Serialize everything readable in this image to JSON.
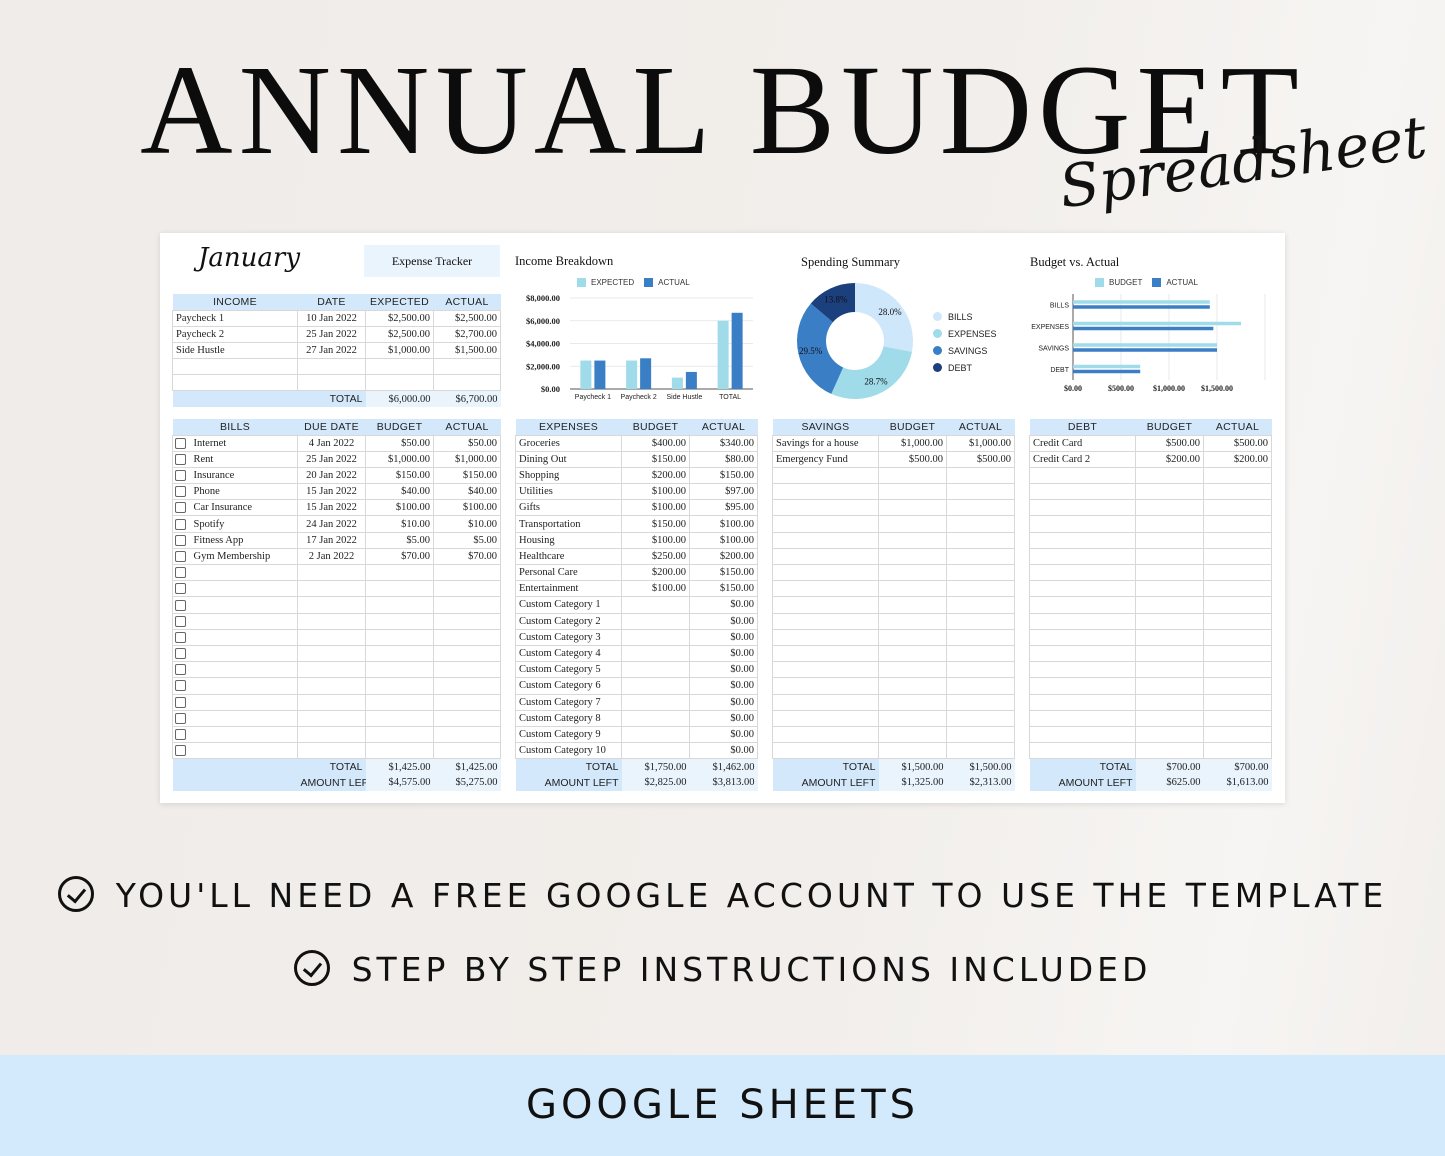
{
  "hero": {
    "title": "ANNUAL BUDGET",
    "script": "Spreadsheet"
  },
  "sheet": {
    "month": "January",
    "tracker_label": "Expense Tracker",
    "income": {
      "headers": [
        "INCOME",
        "DATE",
        "EXPECTED",
        "ACTUAL"
      ],
      "rows": [
        [
          "Paycheck 1",
          "10 Jan 2022",
          "$2,500.00",
          "$2,500.00"
        ],
        [
          "Paycheck 2",
          "25 Jan 2022",
          "$2,500.00",
          "$2,700.00"
        ],
        [
          "Side Hustle",
          "27 Jan 2022",
          "$1,000.00",
          "$1,500.00"
        ],
        [
          "",
          "",
          "",
          ""
        ],
        [
          "",
          "",
          "",
          ""
        ]
      ],
      "total_label": "TOTAL",
      "total_expected": "$6,000.00",
      "total_actual": "$6,700.00"
    },
    "bills": {
      "headers": [
        "BILLS",
        "DUE DATE",
        "BUDGET",
        "ACTUAL"
      ],
      "rows": [
        [
          "Internet",
          "4 Jan 2022",
          "$50.00",
          "$50.00"
        ],
        [
          "Rent",
          "25 Jan 2022",
          "$1,000.00",
          "$1,000.00"
        ],
        [
          "Insurance",
          "20 Jan 2022",
          "$150.00",
          "$150.00"
        ],
        [
          "Phone",
          "15 Jan 2022",
          "$40.00",
          "$40.00"
        ],
        [
          "Car Insurance",
          "15 Jan 2022",
          "$100.00",
          "$100.00"
        ],
        [
          "Spotify",
          "24 Jan 2022",
          "$10.00",
          "$10.00"
        ],
        [
          "Fitness App",
          "17 Jan 2022",
          "$5.00",
          "$5.00"
        ],
        [
          "Gym Membership",
          "2 Jan 2022",
          "$70.00",
          "$70.00"
        ],
        [
          "",
          "",
          "",
          ""
        ],
        [
          "",
          "",
          "",
          ""
        ],
        [
          "",
          "",
          "",
          ""
        ],
        [
          "",
          "",
          "",
          ""
        ],
        [
          "",
          "",
          "",
          ""
        ],
        [
          "",
          "",
          "",
          ""
        ],
        [
          "",
          "",
          "",
          ""
        ],
        [
          "",
          "",
          "",
          ""
        ],
        [
          "",
          "",
          "",
          ""
        ],
        [
          "",
          "",
          "",
          ""
        ],
        [
          "",
          "",
          "",
          ""
        ],
        [
          "",
          "",
          "",
          ""
        ]
      ],
      "total_label": "TOTAL",
      "total_budget": "$1,425.00",
      "total_actual": "$1,425.00",
      "left_label": "AMOUNT LEFT",
      "left_budget": "$4,575.00",
      "left_actual": "$5,275.00"
    },
    "expenses": {
      "headers": [
        "EXPENSES",
        "BUDGET",
        "ACTUAL"
      ],
      "rows": [
        [
          "Groceries",
          "$400.00",
          "$340.00"
        ],
        [
          "Dining Out",
          "$150.00",
          "$80.00"
        ],
        [
          "Shopping",
          "$200.00",
          "$150.00"
        ],
        [
          "Utilities",
          "$100.00",
          "$97.00"
        ],
        [
          "Gifts",
          "$100.00",
          "$95.00"
        ],
        [
          "Transportation",
          "$150.00",
          "$100.00"
        ],
        [
          "Housing",
          "$100.00",
          "$100.00"
        ],
        [
          "Healthcare",
          "$250.00",
          "$200.00"
        ],
        [
          "Personal Care",
          "$200.00",
          "$150.00"
        ],
        [
          "Entertainment",
          "$100.00",
          "$150.00"
        ],
        [
          "Custom Category 1",
          "",
          "$0.00"
        ],
        [
          "Custom Category 2",
          "",
          "$0.00"
        ],
        [
          "Custom Category 3",
          "",
          "$0.00"
        ],
        [
          "Custom Category 4",
          "",
          "$0.00"
        ],
        [
          "Custom Category 5",
          "",
          "$0.00"
        ],
        [
          "Custom Category 6",
          "",
          "$0.00"
        ],
        [
          "Custom Category 7",
          "",
          "$0.00"
        ],
        [
          "Custom Category 8",
          "",
          "$0.00"
        ],
        [
          "Custom Category 9",
          "",
          "$0.00"
        ],
        [
          "Custom Category 10",
          "",
          "$0.00"
        ]
      ],
      "total_label": "TOTAL",
      "total_budget": "$1,750.00",
      "total_actual": "$1,462.00",
      "left_label": "AMOUNT LEFT",
      "left_budget": "$2,825.00",
      "left_actual": "$3,813.00"
    },
    "savings": {
      "headers": [
        "SAVINGS",
        "BUDGET",
        "ACTUAL"
      ],
      "rows": [
        [
          "Savings for a house",
          "$1,000.00",
          "$1,000.00"
        ],
        [
          "Emergency Fund",
          "$500.00",
          "$500.00"
        ],
        [
          "",
          "",
          ""
        ],
        [
          "",
          "",
          ""
        ],
        [
          "",
          "",
          ""
        ],
        [
          "",
          "",
          ""
        ],
        [
          "",
          "",
          ""
        ],
        [
          "",
          "",
          ""
        ],
        [
          "",
          "",
          ""
        ],
        [
          "",
          "",
          ""
        ],
        [
          "",
          "",
          ""
        ],
        [
          "",
          "",
          ""
        ],
        [
          "",
          "",
          ""
        ],
        [
          "",
          "",
          ""
        ],
        [
          "",
          "",
          ""
        ],
        [
          "",
          "",
          ""
        ],
        [
          "",
          "",
          ""
        ],
        [
          "",
          "",
          ""
        ],
        [
          "",
          "",
          ""
        ],
        [
          "",
          "",
          ""
        ]
      ],
      "total_label": "TOTAL",
      "total_budget": "$1,500.00",
      "total_actual": "$1,500.00",
      "left_label": "AMOUNT LEFT",
      "left_budget": "$1,325.00",
      "left_actual": "$2,313.00"
    },
    "debt": {
      "headers": [
        "DEBT",
        "BUDGET",
        "ACTUAL"
      ],
      "rows": [
        [
          "Credit Card",
          "$500.00",
          "$500.00"
        ],
        [
          "Credit Card 2",
          "$200.00",
          "$200.00"
        ],
        [
          "",
          "",
          ""
        ],
        [
          "",
          "",
          ""
        ],
        [
          "",
          "",
          ""
        ],
        [
          "",
          "",
          ""
        ],
        [
          "",
          "",
          ""
        ],
        [
          "",
          "",
          ""
        ],
        [
          "",
          "",
          ""
        ],
        [
          "",
          "",
          ""
        ],
        [
          "",
          "",
          ""
        ],
        [
          "",
          "",
          ""
        ],
        [
          "",
          "",
          ""
        ],
        [
          "",
          "",
          ""
        ],
        [
          "",
          "",
          ""
        ],
        [
          "",
          "",
          ""
        ],
        [
          "",
          "",
          ""
        ],
        [
          "",
          "",
          ""
        ],
        [
          "",
          "",
          ""
        ],
        [
          "",
          "",
          ""
        ]
      ],
      "total_label": "TOTAL",
      "total_budget": "$700.00",
      "total_actual": "$700.00",
      "left_label": "AMOUNT LEFT",
      "left_budget": "$625.00",
      "left_actual": "$1,613.00"
    }
  },
  "colors": {
    "light_blue": "#9fdbe8",
    "mid_blue": "#3a7fc6",
    "pale_blue": "#cfe7fb",
    "navy": "#1c3f7e",
    "header_bg": "#d3e9fb",
    "footer_bg": "#d2eafc"
  },
  "chart_data": [
    {
      "type": "bar",
      "title": "Income Breakdown",
      "categories": [
        "Paycheck 1",
        "Paycheck 2",
        "Side Hustle",
        "TOTAL"
      ],
      "series": [
        {
          "name": "EXPECTED",
          "values": [
            2500,
            2500,
            1000,
            6000
          ],
          "color": "#9fdbe8"
        },
        {
          "name": "ACTUAL",
          "values": [
            2500,
            2700,
            1500,
            6700
          ],
          "color": "#3a7fc6"
        }
      ],
      "ylim": [
        0,
        8000
      ],
      "yticks": [
        "$0.00",
        "$2,000.00",
        "$4,000.00",
        "$6,000.00",
        "$8,000.00"
      ],
      "ytick_values": [
        0,
        2000,
        4000,
        6000,
        8000
      ],
      "xlabel": "",
      "ylabel": "",
      "legend": "top",
      "grid": true
    },
    {
      "type": "pie",
      "title": "Spending Summary",
      "donut": true,
      "categories": [
        "BILLS",
        "EXPENSES",
        "SAVINGS",
        "DEBT"
      ],
      "values": [
        28.0,
        28.7,
        29.5,
        13.8
      ],
      "labels": [
        "28.0%",
        "28.7%",
        "29.5%",
        "13.8%"
      ],
      "colors": [
        "#cfe7fb",
        "#9fdbe8",
        "#3a7fc6",
        "#1c3f7e"
      ],
      "legend": "right"
    },
    {
      "type": "bar",
      "orientation": "horizontal",
      "title": "Budget vs. Actual",
      "categories": [
        "BILLS",
        "EXPENSES",
        "SAVINGS",
        "DEBT"
      ],
      "series": [
        {
          "name": "BUDGET",
          "values": [
            1425,
            1750,
            1500,
            700
          ],
          "color": "#9fdbe8"
        },
        {
          "name": "ACTUAL",
          "values": [
            1425,
            1462,
            1500,
            700
          ],
          "color": "#3a7fc6"
        }
      ],
      "xlim": [
        0,
        2000
      ],
      "xticks": [
        "$0.00",
        "$500.00",
        "$1,000.00",
        "$1,500.00"
      ],
      "xtick_values": [
        0,
        500,
        1000,
        1500
      ],
      "legend": "top",
      "grid": true
    }
  ],
  "features": [
    "YOU'LL NEED A FREE GOOGLE ACCOUNT TO USE THE TEMPLATE",
    "STEP BY STEP INSTRUCTIONS INCLUDED"
  ],
  "footer": {
    "label": "GOOGLE SHEETS"
  }
}
